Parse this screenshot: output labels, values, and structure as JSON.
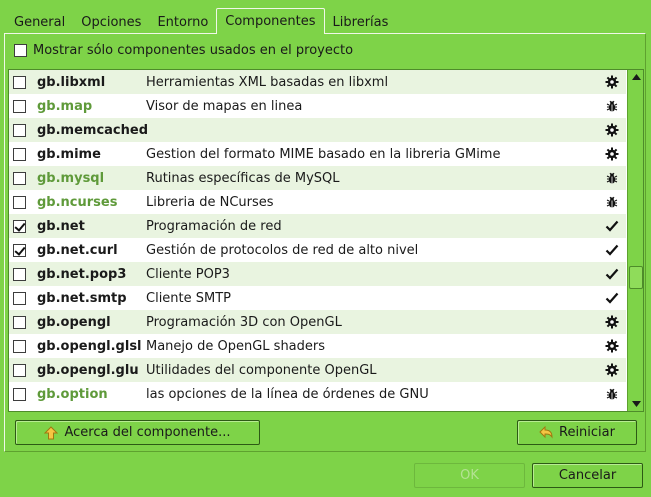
{
  "tabs": [
    {
      "label": "General"
    },
    {
      "label": "Opciones"
    },
    {
      "label": "Entorno"
    },
    {
      "label": "Componentes",
      "active": true
    },
    {
      "label": "Librerías"
    }
  ],
  "show_used_label": "Mostrar sólo componentes usados en el proyecto",
  "components": [
    {
      "name": "gb.libxml",
      "desc": "Herramientas XML basadas en libxml",
      "checked": false,
      "dim": false,
      "icon": "gear-icon"
    },
    {
      "name": "gb.map",
      "desc": "Visor de mapas en linea",
      "checked": false,
      "dim": true,
      "icon": "bug-icon"
    },
    {
      "name": "gb.memcached",
      "desc": "",
      "checked": false,
      "dim": false,
      "icon": "gear-icon"
    },
    {
      "name": "gb.mime",
      "desc": "Gestion del formato MIME basado en la libreria GMime",
      "checked": false,
      "dim": false,
      "icon": "gear-icon"
    },
    {
      "name": "gb.mysql",
      "desc": "Rutinas específicas de MySQL",
      "checked": false,
      "dim": true,
      "icon": "bug-icon"
    },
    {
      "name": "gb.ncurses",
      "desc": "Libreria de NCurses",
      "checked": false,
      "dim": true,
      "icon": "bug-icon"
    },
    {
      "name": "gb.net",
      "desc": "Programación de red",
      "checked": true,
      "dim": false,
      "icon": "check-icon"
    },
    {
      "name": "gb.net.curl",
      "desc": "Gestión de protocolos de red de alto nivel",
      "checked": true,
      "dim": false,
      "icon": "check-icon"
    },
    {
      "name": "gb.net.pop3",
      "desc": "Cliente POP3",
      "checked": false,
      "dim": false,
      "icon": "check-icon"
    },
    {
      "name": "gb.net.smtp",
      "desc": "Cliente SMTP",
      "checked": false,
      "dim": false,
      "icon": "check-icon"
    },
    {
      "name": "gb.opengl",
      "desc": "Programación 3D con OpenGL",
      "checked": false,
      "dim": false,
      "icon": "gear-icon"
    },
    {
      "name": "gb.opengl.glsl",
      "desc": "Manejo de OpenGL shaders",
      "checked": false,
      "dim": false,
      "icon": "gear-icon"
    },
    {
      "name": "gb.opengl.glu",
      "desc": "Utilidades del componente OpenGL",
      "checked": false,
      "dim": false,
      "icon": "gear-icon"
    },
    {
      "name": "gb.option",
      "desc": "las opciones de la línea de órdenes de GNU",
      "checked": false,
      "dim": true,
      "icon": "bug-icon"
    }
  ],
  "buttons": {
    "about": "Acerca del componente...",
    "reset": "Reiniciar",
    "ok": "OK",
    "cancel": "Cancelar"
  },
  "colors": {
    "window_bg": "#7ed348",
    "row_alt": "#e9f4e0",
    "dim_text": "#5f9a3a"
  }
}
